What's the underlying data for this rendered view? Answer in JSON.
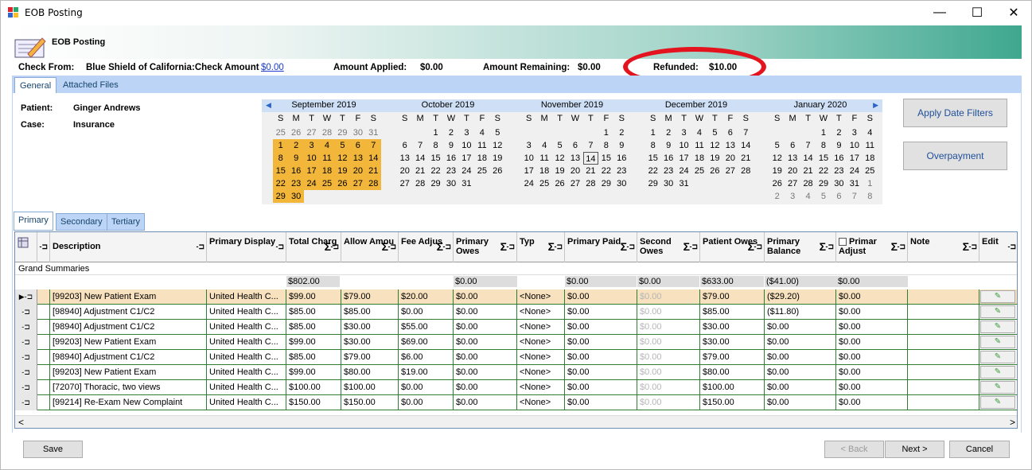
{
  "window": {
    "title": "EOB Posting",
    "minimize": "—",
    "maximize": "☐",
    "close": "✕"
  },
  "banner": {
    "title": "EOB Posting"
  },
  "check": {
    "from_label": "Check From:",
    "from_value": "Blue Shield of California",
    "amount_label": "Check Amount:",
    "amount_value": "$0.00",
    "applied_label": "Amount Applied:",
    "applied_value": "$0.00",
    "remaining_label": "Amount Remaining:",
    "remaining_value": "$0.00",
    "refunded_label": "Refunded:",
    "refunded_value": "$10.00"
  },
  "tabs": [
    "General",
    "Attached Files"
  ],
  "patient": {
    "patient_label": "Patient:",
    "patient_value": "Ginger Andrews",
    "case_label": "Case:",
    "case_value": "Insurance"
  },
  "calendars": [
    {
      "title": "September 2019",
      "days": [
        "25",
        "26",
        "27",
        "28",
        "29",
        "30",
        "31",
        "1",
        "2",
        "3",
        "4",
        "5",
        "6",
        "7",
        "8",
        "9",
        "10",
        "11",
        "12",
        "13",
        "14",
        "15",
        "16",
        "17",
        "18",
        "19",
        "20",
        "21",
        "22",
        "23",
        "24",
        "25",
        "26",
        "27",
        "28",
        "29",
        "30"
      ],
      "lead_other": 7,
      "selected_all": true
    },
    {
      "title": "October 2019",
      "days": [
        "",
        "",
        "1",
        "2",
        "3",
        "4",
        "5",
        "6",
        "7",
        "8",
        "9",
        "10",
        "11",
        "12",
        "13",
        "14",
        "15",
        "16",
        "17",
        "18",
        "19",
        "20",
        "21",
        "22",
        "23",
        "24",
        "25",
        "26",
        "27",
        "28",
        "29",
        "30",
        "31"
      ]
    },
    {
      "title": "November 2019",
      "days": [
        "",
        "",
        "",
        "",
        "",
        "1",
        "2",
        "3",
        "4",
        "5",
        "6",
        "7",
        "8",
        "9",
        "10",
        "11",
        "12",
        "13",
        "14",
        "15",
        "16",
        "17",
        "18",
        "19",
        "20",
        "21",
        "22",
        "23",
        "24",
        "25",
        "26",
        "27",
        "28",
        "29",
        "30"
      ],
      "today": "14"
    },
    {
      "title": "December 2019",
      "days": [
        "1",
        "2",
        "3",
        "4",
        "5",
        "6",
        "7",
        "8",
        "9",
        "10",
        "11",
        "12",
        "13",
        "14",
        "15",
        "16",
        "17",
        "18",
        "19",
        "20",
        "21",
        "22",
        "23",
        "24",
        "25",
        "26",
        "27",
        "28",
        "29",
        "30",
        "31"
      ]
    },
    {
      "title": "January 2020",
      "days": [
        "",
        "",
        "",
        "1",
        "2",
        "3",
        "4",
        "5",
        "6",
        "7",
        "8",
        "9",
        "10",
        "11",
        "12",
        "13",
        "14",
        "15",
        "16",
        "17",
        "18",
        "19",
        "20",
        "21",
        "22",
        "23",
        "24",
        "25",
        "26",
        "27",
        "28",
        "29",
        "30",
        "31",
        "1",
        "2",
        "3",
        "4",
        "5",
        "6",
        "7",
        "8"
      ],
      "trail_other": 8
    }
  ],
  "dow": [
    "S",
    "M",
    "T",
    "W",
    "T",
    "F",
    "S"
  ],
  "side_buttons": {
    "apply": "Apply Date Filters",
    "overpayment": "Overpayment"
  },
  "grid_tabs": [
    "Primary",
    "Secondary",
    "Tertiary"
  ],
  "columns": [
    {
      "label": "Description"
    },
    {
      "label": "Primary Display"
    },
    {
      "label": "Total Charg"
    },
    {
      "label": "Allow Amou"
    },
    {
      "label": "Fee Adjus"
    },
    {
      "label": "Primary Owes"
    },
    {
      "label": "Typ"
    },
    {
      "label": "Primary Paid"
    },
    {
      "label": "Second Owes"
    },
    {
      "label": "Patient Owes"
    },
    {
      "label": "Primary Balance"
    },
    {
      "label": "Primar Adjust"
    },
    {
      "label": "Note"
    },
    {
      "label": "Edit"
    }
  ],
  "grand_summaries": "Grand Summaries",
  "summaries": {
    "total": "$802.00",
    "primary_owes": "$0.00",
    "primary_paid": "$0.00",
    "second_owes": "$0.00",
    "patient_owes": "$633.00",
    "primary_balance": "($41.00)",
    "primary_adjust": "$0.00"
  },
  "rows": [
    [
      "[99203] New Patient Exam",
      "United Health C...",
      "$99.00",
      "$79.00",
      "$20.00",
      "$0.00",
      "<None>",
      "$0.00",
      "$0.00",
      "$79.00",
      "($29.20)",
      "$0.00"
    ],
    [
      "[98940] Adjustment C1/C2",
      "United Health C...",
      "$85.00",
      "$85.00",
      "$0.00",
      "$0.00",
      "<None>",
      "$0.00",
      "$0.00",
      "$85.00",
      "($11.80)",
      "$0.00"
    ],
    [
      "[98940] Adjustment C1/C2",
      "United Health C...",
      "$85.00",
      "$30.00",
      "$55.00",
      "$0.00",
      "<None>",
      "$0.00",
      "$0.00",
      "$30.00",
      "$0.00",
      "$0.00"
    ],
    [
      "[99203] New Patient Exam",
      "United Health C...",
      "$99.00",
      "$30.00",
      "$69.00",
      "$0.00",
      "<None>",
      "$0.00",
      "$0.00",
      "$30.00",
      "$0.00",
      "$0.00"
    ],
    [
      "[98940] Adjustment C1/C2",
      "United Health C...",
      "$85.00",
      "$79.00",
      "$6.00",
      "$0.00",
      "<None>",
      "$0.00",
      "$0.00",
      "$79.00",
      "$0.00",
      "$0.00"
    ],
    [
      "[99203] New Patient Exam",
      "United Health C...",
      "$99.00",
      "$80.00",
      "$19.00",
      "$0.00",
      "<None>",
      "$0.00",
      "$0.00",
      "$80.00",
      "$0.00",
      "$0.00"
    ],
    [
      "[72070] Thoracic, two views",
      "United Health C...",
      "$100.00",
      "$100.00",
      "$0.00",
      "$0.00",
      "<None>",
      "$0.00",
      "$0.00",
      "$100.00",
      "$0.00",
      "$0.00"
    ],
    [
      "[99214] Re-Exam New Complaint",
      "United Health C...",
      "$150.00",
      "$150.00",
      "$0.00",
      "$0.00",
      "<None>",
      "$0.00",
      "$0.00",
      "$150.00",
      "$0.00",
      "$0.00"
    ]
  ],
  "footer": {
    "save": "Save",
    "back": "< Back",
    "next": "Next >",
    "cancel": "Cancel"
  }
}
